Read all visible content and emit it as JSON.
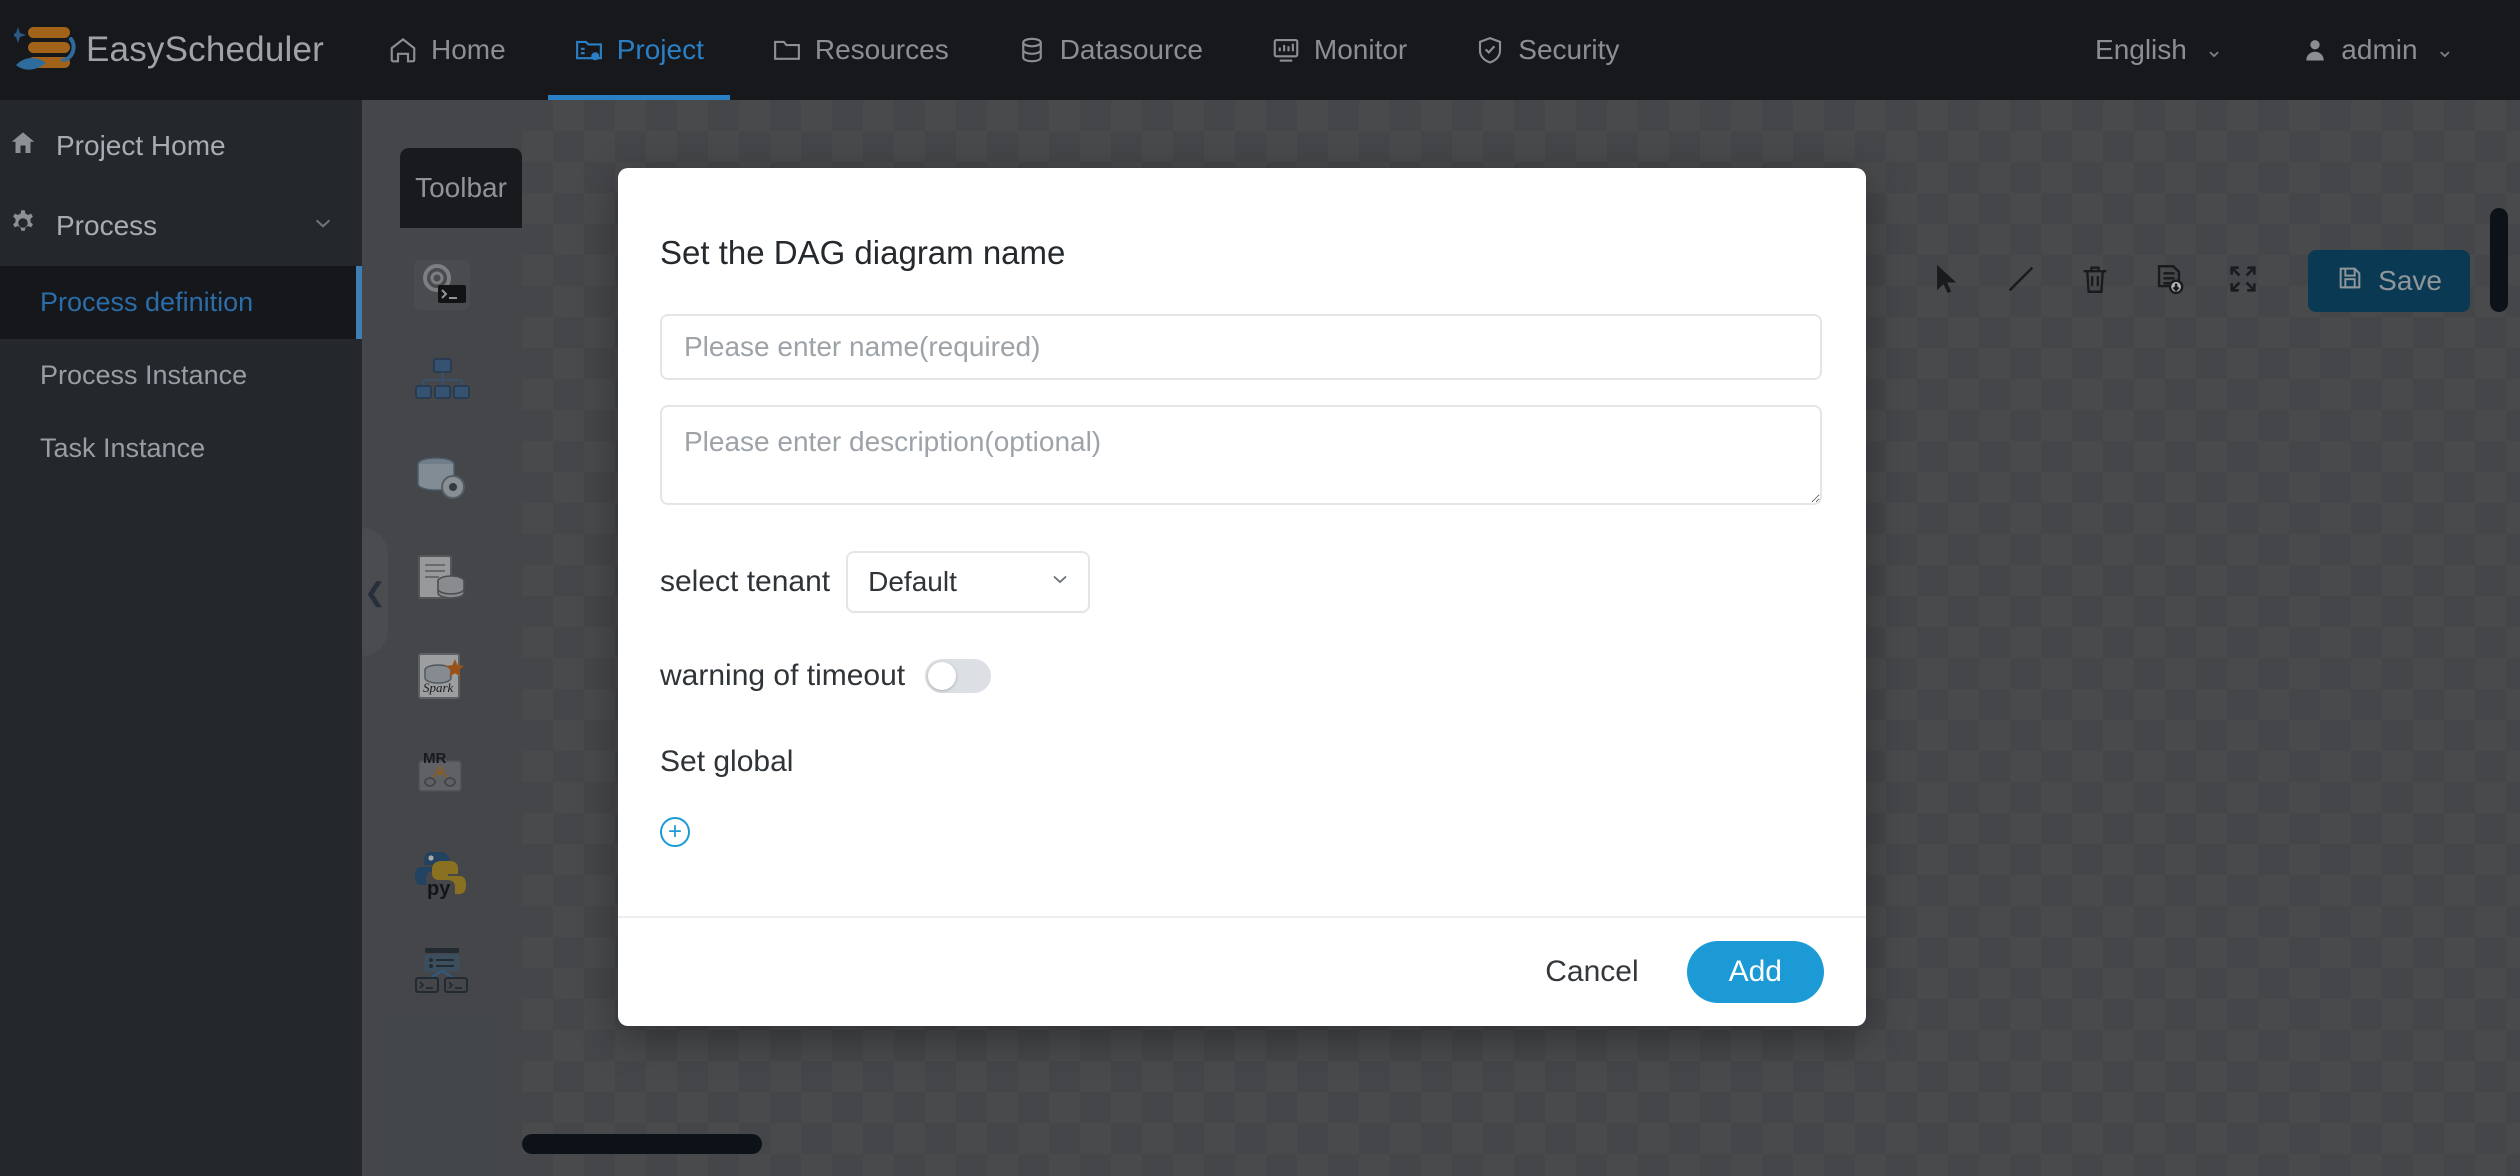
{
  "app": {
    "brand": "EasyScheduler",
    "accent_blue": "#2b7fc4",
    "primary_blue": "#1c9ad6",
    "logo_orange": "#a1621a"
  },
  "topnav": {
    "items": [
      {
        "label": "Home",
        "icon": "home-icon",
        "active": false
      },
      {
        "label": "Project",
        "icon": "project-icon",
        "active": true
      },
      {
        "label": "Resources",
        "icon": "folder-icon",
        "active": false
      },
      {
        "label": "Datasource",
        "icon": "database-icon",
        "active": false
      },
      {
        "label": "Monitor",
        "icon": "monitor-icon",
        "active": false
      },
      {
        "label": "Security",
        "icon": "shield-check-icon",
        "active": false
      }
    ],
    "language": "English",
    "user": "admin"
  },
  "sidebar": {
    "items": [
      {
        "label": "Project Home",
        "icon": "home-icon"
      },
      {
        "label": "Process",
        "icon": "gear-icon"
      }
    ],
    "sub_items": [
      {
        "label": "Process definition",
        "active": true
      },
      {
        "label": "Process Instance",
        "active": false
      },
      {
        "label": "Task Instance",
        "active": false
      }
    ]
  },
  "canvas": {
    "toolbar_tab": "Toolbar",
    "code_button": "</>",
    "palette": [
      {
        "name": "shell-task-icon",
        "label": "SHELL"
      },
      {
        "name": "sub-process-task-icon",
        "label": "SUB_PROCESS"
      },
      {
        "name": "procedure-task-icon",
        "label": "PROCEDURE"
      },
      {
        "name": "sql-task-icon",
        "label": "SQL"
      },
      {
        "name": "spark-task-icon",
        "label": "SPARK"
      },
      {
        "name": "mapreduce-task-icon",
        "label": "MR"
      },
      {
        "name": "python-task-icon",
        "label": "PYTHON"
      },
      {
        "name": "dependent-task-icon",
        "label": "DEPENDENT"
      }
    ],
    "tools": [
      {
        "name": "pointer-icon"
      },
      {
        "name": "line-icon"
      },
      {
        "name": "trash-icon"
      },
      {
        "name": "download-format-icon"
      },
      {
        "name": "fullscreen-icon"
      }
    ],
    "save_label": "Save",
    "collapse_icon": "chevron-left-icon"
  },
  "modal": {
    "title": "Set the DAG diagram name",
    "name_placeholder": "Please enter name(required)",
    "name_value": "",
    "description_placeholder": "Please enter description(optional)",
    "description_value": "",
    "tenant_label": "select tenant",
    "tenant_value": "Default",
    "tenant_options": [
      "Default"
    ],
    "timeout_label": "warning of timeout",
    "timeout_enabled": false,
    "global_label": "Set global",
    "add_param_icon": "plus-circle-icon",
    "cancel_label": "Cancel",
    "add_label": "Add"
  }
}
